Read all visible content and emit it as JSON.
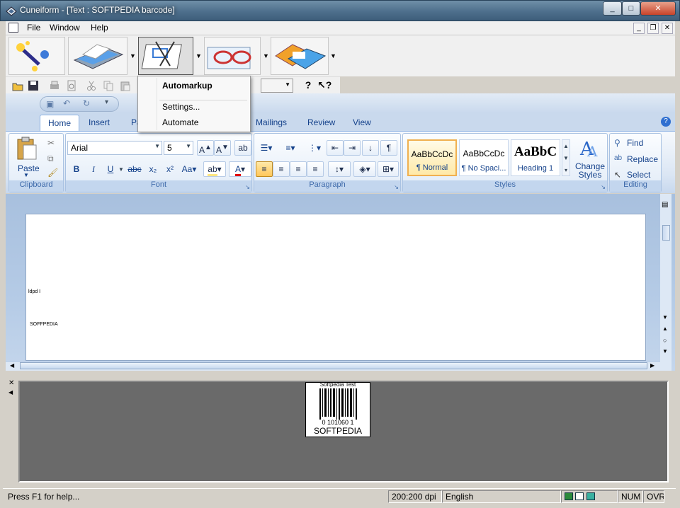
{
  "window": {
    "title": "Cuneiform - [Text : SOFTPEDIA barcode]",
    "min": "_",
    "max": "□",
    "close": "✕"
  },
  "menu": {
    "items": [
      "File",
      "Window",
      "Help"
    ]
  },
  "mdi": {
    "min": "_",
    "restore": "❐",
    "close": "✕"
  },
  "popup": {
    "items": [
      "Automarkup",
      "Settings...",
      "Automate"
    ]
  },
  "tabs": [
    "Home",
    "Insert",
    "Pa",
    "Mailings",
    "Review",
    "View"
  ],
  "clipboard": {
    "paste": "Paste",
    "label": "Clipboard"
  },
  "font": {
    "name": "Arial",
    "size": "5",
    "label": "Font"
  },
  "paragraph": {
    "label": "Paragraph"
  },
  "styles": {
    "label": "Styles",
    "items": [
      {
        "preview": "AaBbCcDc",
        "name": "¶ Normal"
      },
      {
        "preview": "AaBbCcDc",
        "name": "¶ No Spaci..."
      },
      {
        "preview": "AaBbC",
        "name": "Heading 1"
      }
    ],
    "change": "Change Styles"
  },
  "editing": {
    "find": "Find",
    "replace": "Replace",
    "select": "Select",
    "label": "Editing"
  },
  "document": {
    "line1": "ldpd I",
    "line2": "SOFFPEDIA"
  },
  "barcode": {
    "top_text": "Softpedia Test",
    "number": "0 101060 1",
    "caption": "SOFTPEDIA"
  },
  "status": {
    "help": "Press F1 for help...",
    "dpi": "200:200 dpi",
    "lang": "English",
    "num": "NUM",
    "ovr": "OVR"
  },
  "colors": {
    "title": "#4e6f8c",
    "ribbon_text": "#15428b",
    "highlight": "#ffe680",
    "font_color": "#e00000"
  }
}
